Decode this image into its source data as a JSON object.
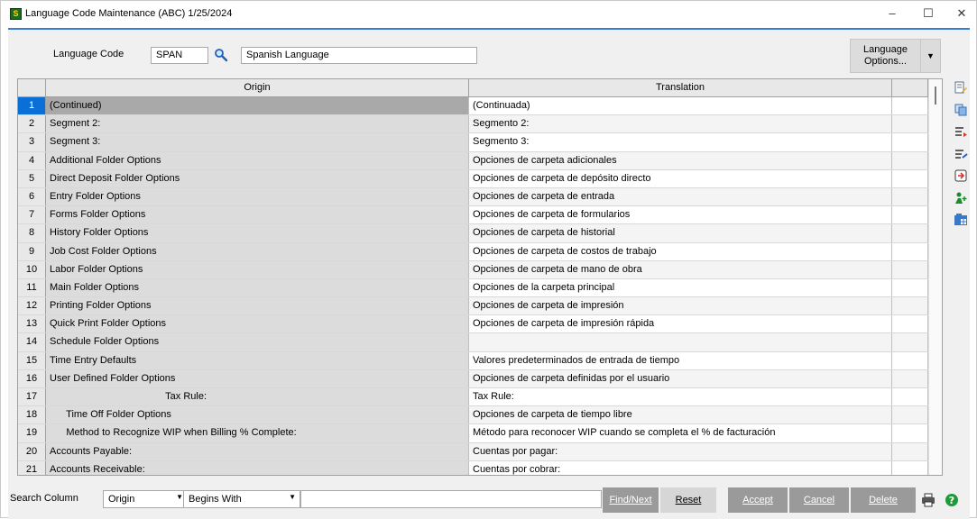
{
  "window": {
    "title": "Language Code Maintenance (ABC) 1/25/2024",
    "minimize": "–",
    "maximize": "☐",
    "close": "✕"
  },
  "header": {
    "language_code_label": "Language Code",
    "language_code_value": "SPAN",
    "description_value": "Spanish Language",
    "language_options_label": "Language\nOptions...",
    "dropdown_arrow": "▼"
  },
  "grid": {
    "columns": [
      "Origin",
      "Translation"
    ],
    "selected_row": 1,
    "rows": [
      {
        "num": "1",
        "origin": "(Continued)",
        "translation": "(Continuada)"
      },
      {
        "num": "2",
        "origin": "Segment 2:",
        "translation": "Segmento 2:"
      },
      {
        "num": "3",
        "origin": "Segment 3:",
        "translation": "Segmento 3:"
      },
      {
        "num": "4",
        "origin": "Additional Folder Options",
        "translation": "Opciones de carpeta adicionales"
      },
      {
        "num": "5",
        "origin": "Direct Deposit Folder Options",
        "translation": "Opciones de carpeta de depósito directo"
      },
      {
        "num": "6",
        "origin": "Entry Folder Options",
        "translation": "Opciones de carpeta de entrada"
      },
      {
        "num": "7",
        "origin": "Forms Folder Options",
        "translation": "Opciones de carpeta de formularios"
      },
      {
        "num": "8",
        "origin": "History Folder Options",
        "translation": "Opciones de carpeta de historial"
      },
      {
        "num": "9",
        "origin": "Job Cost Folder Options",
        "translation": "Opciones de carpeta de costos de trabajo"
      },
      {
        "num": "10",
        "origin": "Labor Folder Options",
        "translation": "Opciones de carpeta de mano de obra"
      },
      {
        "num": "11",
        "origin": "Main Folder Options",
        "translation": "Opciones de la carpeta principal"
      },
      {
        "num": "12",
        "origin": "Printing Folder Options",
        "translation": "Opciones de carpeta de impresión"
      },
      {
        "num": "13",
        "origin": "Quick Print Folder Options",
        "translation": "Opciones de carpeta de impresión rápida"
      },
      {
        "num": "14",
        "origin": "Schedule Folder Options",
        "translation": ""
      },
      {
        "num": "15",
        "origin": "Time Entry Defaults",
        "translation": "Valores predeterminados de entrada de tiempo"
      },
      {
        "num": "16",
        "origin": "User Defined Folder Options",
        "translation": "Opciones de carpeta definidas por el usuario"
      },
      {
        "num": "17",
        "origin": "                                          Tax Rule:",
        "translation": "Tax Rule:"
      },
      {
        "num": "18",
        "origin": "      Time Off Folder Options",
        "translation": "Opciones de carpeta de tiempo libre"
      },
      {
        "num": "19",
        "origin": "      Method to Recognize WIP when Billing % Complete:",
        "translation": "Método para reconocer WIP cuando se completa el % de facturación"
      },
      {
        "num": "20",
        "origin": "Accounts Payable:",
        "translation": "Cuentas por pagar:"
      },
      {
        "num": "21",
        "origin": "Accounts Receivable:",
        "translation": "Cuentas por cobrar:"
      }
    ]
  },
  "side_tools": [
    "edit-icon",
    "copy-icon",
    "insert-row-icon",
    "delete-row-icon",
    "import-icon",
    "user-add-icon",
    "grid-settings-icon"
  ],
  "bottom": {
    "search_column_label": "Search Column",
    "search_column_value": "Origin",
    "search_operator_value": "Begins With",
    "search_value": "",
    "find_next": "Find/Next",
    "reset": "Reset",
    "accept": "Accept",
    "cancel": "Cancel",
    "delete": "Delete"
  },
  "colors": {
    "selected_row_number": "#0a6fd6",
    "accent_line": "#3a7bd5",
    "button_gray": "#9a9a9a"
  }
}
